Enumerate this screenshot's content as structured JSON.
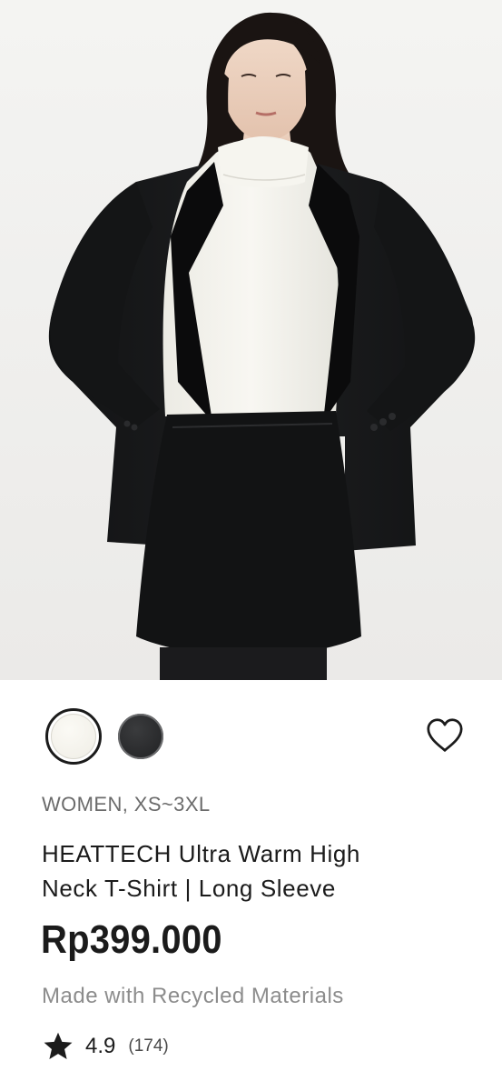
{
  "product": {
    "image_alt": "Model wearing white high neck T-shirt with black blazer and skirt",
    "colors": [
      {
        "name": "White",
        "hex": "#f1efe8",
        "selected": true
      },
      {
        "name": "Black",
        "hex": "#2a2b2d",
        "selected": false
      }
    ],
    "category": "WOMEN, XS~3XL",
    "title_line1": "HEATTECH Ultra Warm High",
    "title_line2": "Neck T-Shirt | Long Sleeve",
    "price": "Rp399.000",
    "note": "Made with Recycled Materials",
    "rating": "4.9",
    "review_count": "(174)"
  },
  "icons": {
    "wishlist": "heart-outline-icon",
    "rating": "star-icon"
  },
  "colors": {
    "text_primary": "#1b1b1b",
    "text_secondary": "#6b6b6b",
    "text_muted": "#8c8c8c",
    "background": "#ffffff"
  }
}
